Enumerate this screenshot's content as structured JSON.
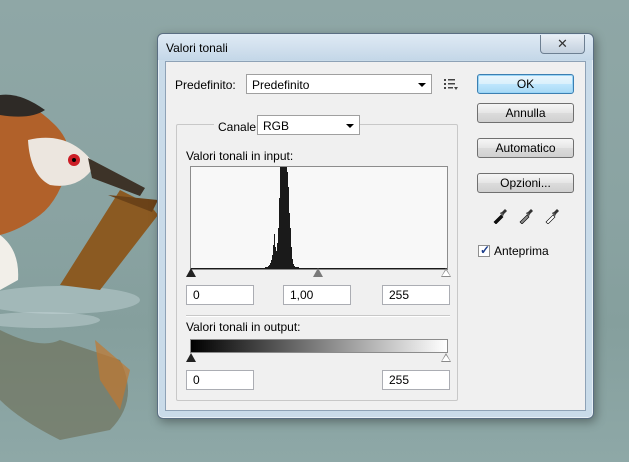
{
  "window": {
    "title": "Valori tonali",
    "close_glyph": "✕"
  },
  "preset": {
    "label": "Predefinito:",
    "value": "Predefinito",
    "menu_icon": "preset-options-icon"
  },
  "channel": {
    "label": "Canale:",
    "value": "RGB"
  },
  "input": {
    "label": "Valori tonali in input:",
    "black": "0",
    "gamma": "1,00",
    "white": "255"
  },
  "output": {
    "label": "Valori tonali in output:",
    "black": "0",
    "white": "255"
  },
  "buttons": {
    "ok": "OK",
    "cancel": "Annulla",
    "auto": "Automatico",
    "options": "Opzioni..."
  },
  "eyedroppers": [
    "black-point-eyedropper-icon",
    "gray-point-eyedropper-icon",
    "white-point-eyedropper-icon"
  ],
  "preview": {
    "label": "Anteprima",
    "checked": true
  },
  "histogram": {
    "bins": [
      1,
      1,
      1,
      1,
      1,
      1,
      1,
      1,
      1,
      1,
      1,
      1,
      1,
      1,
      1,
      1,
      1,
      1,
      1,
      1,
      1,
      1,
      1,
      1,
      1,
      1,
      1,
      1,
      1,
      1,
      1,
      1,
      1,
      1,
      1,
      1,
      1,
      1,
      1,
      1,
      1,
      1,
      1,
      1,
      1,
      1,
      1,
      1,
      1,
      1,
      1,
      1,
      1,
      1,
      1,
      1,
      1,
      1,
      1,
      1,
      1,
      1,
      1,
      1,
      1,
      1,
      1,
      1,
      1,
      1,
      1,
      1,
      1,
      1,
      2,
      2,
      2,
      3,
      4,
      6,
      9,
      14,
      24,
      34,
      22,
      18,
      25,
      40,
      70,
      100,
      100,
      100,
      100,
      100,
      100,
      100,
      95,
      80,
      55,
      40,
      22,
      10,
      5,
      3,
      2,
      2,
      2,
      2,
      1,
      1,
      1,
      1,
      1,
      1,
      1,
      1,
      1,
      1,
      1,
      1,
      1,
      1,
      1,
      1,
      1,
      1,
      1,
      1,
      1,
      1,
      1,
      1,
      1,
      1,
      1,
      1,
      1,
      1,
      1,
      1,
      1,
      1,
      1,
      1,
      1,
      1,
      1,
      1,
      1,
      1,
      1,
      1,
      1,
      1,
      1,
      1,
      1,
      1,
      1,
      1,
      1,
      1,
      1,
      1,
      1,
      1,
      1,
      1,
      1,
      1,
      1,
      1,
      1,
      1,
      1,
      1,
      1,
      1,
      1,
      1,
      1,
      1,
      1,
      1,
      1,
      1,
      1,
      1,
      1,
      1,
      1,
      1,
      1,
      1,
      1,
      1,
      1,
      1,
      1,
      1,
      1,
      1,
      1,
      1,
      1,
      1,
      1,
      1,
      1,
      1,
      1,
      1,
      1,
      1,
      1,
      1,
      1,
      1,
      1,
      1,
      1,
      1,
      1,
      1,
      1,
      1,
      1,
      1,
      1,
      1,
      1,
      1,
      1,
      1,
      1,
      1,
      1,
      1,
      1,
      1,
      1,
      1,
      1,
      1,
      1,
      1,
      1,
      1,
      1,
      1,
      1,
      1,
      1,
      1,
      1,
      1,
      1,
      1,
      1,
      1,
      1,
      1,
      1,
      1,
      1,
      1,
      1,
      1,
      1
    ]
  },
  "colors": {
    "accent": "#3c7fb1",
    "histogram_fill": "#1a1a1a"
  }
}
